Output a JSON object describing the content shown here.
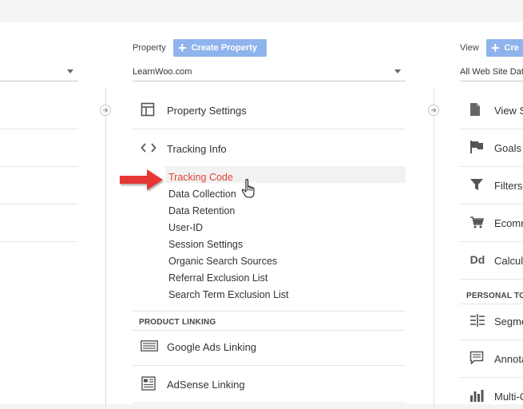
{
  "property_column": {
    "header_label": "Property",
    "create_button_label": "Create Property",
    "selected_property": "LearnWoo.com",
    "items": {
      "property_settings": "Property Settings",
      "tracking_info": "Tracking Info"
    },
    "tracking_info_subitems": [
      "Tracking Code",
      "Data Collection",
      "Data Retention",
      "User-ID",
      "Session Settings",
      "Organic Search Sources",
      "Referral Exclusion List",
      "Search Term Exclusion List"
    ],
    "active_subitem": "Tracking Code",
    "product_linking_label": "PRODUCT LINKING",
    "linking_items": {
      "google_ads": "Google Ads Linking",
      "adsense": "AdSense Linking"
    }
  },
  "view_column": {
    "header_label": "View",
    "create_button_label": "Cre",
    "selected_view": "All Web Site Data",
    "items": [
      "View S",
      "Goals",
      "Filters",
      "Ecomm",
      "Calcul"
    ],
    "personal_tools_label": "PERSONAL TO",
    "personal_items": [
      "Segme",
      "Annota",
      "Multi-C"
    ]
  },
  "colors": {
    "active_link": "#db4437",
    "create_button": "#8fb3ec",
    "pointer_arrow": "#e53935"
  }
}
